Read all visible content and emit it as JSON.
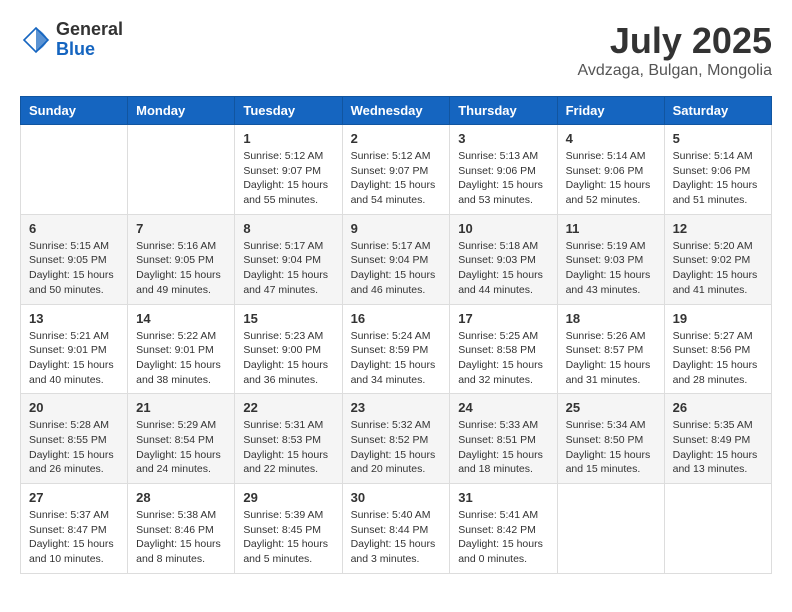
{
  "header": {
    "logo_general": "General",
    "logo_blue": "Blue",
    "title": "July 2025",
    "location": "Avdzaga, Bulgan, Mongolia"
  },
  "days_of_week": [
    "Sunday",
    "Monday",
    "Tuesday",
    "Wednesday",
    "Thursday",
    "Friday",
    "Saturday"
  ],
  "weeks": [
    [
      {
        "day": "",
        "content": ""
      },
      {
        "day": "",
        "content": ""
      },
      {
        "day": "1",
        "content": "Sunrise: 5:12 AM\nSunset: 9:07 PM\nDaylight: 15 hours\nand 55 minutes."
      },
      {
        "day": "2",
        "content": "Sunrise: 5:12 AM\nSunset: 9:07 PM\nDaylight: 15 hours\nand 54 minutes."
      },
      {
        "day": "3",
        "content": "Sunrise: 5:13 AM\nSunset: 9:06 PM\nDaylight: 15 hours\nand 53 minutes."
      },
      {
        "day": "4",
        "content": "Sunrise: 5:14 AM\nSunset: 9:06 PM\nDaylight: 15 hours\nand 52 minutes."
      },
      {
        "day": "5",
        "content": "Sunrise: 5:14 AM\nSunset: 9:06 PM\nDaylight: 15 hours\nand 51 minutes."
      }
    ],
    [
      {
        "day": "6",
        "content": "Sunrise: 5:15 AM\nSunset: 9:05 PM\nDaylight: 15 hours\nand 50 minutes."
      },
      {
        "day": "7",
        "content": "Sunrise: 5:16 AM\nSunset: 9:05 PM\nDaylight: 15 hours\nand 49 minutes."
      },
      {
        "day": "8",
        "content": "Sunrise: 5:17 AM\nSunset: 9:04 PM\nDaylight: 15 hours\nand 47 minutes."
      },
      {
        "day": "9",
        "content": "Sunrise: 5:17 AM\nSunset: 9:04 PM\nDaylight: 15 hours\nand 46 minutes."
      },
      {
        "day": "10",
        "content": "Sunrise: 5:18 AM\nSunset: 9:03 PM\nDaylight: 15 hours\nand 44 minutes."
      },
      {
        "day": "11",
        "content": "Sunrise: 5:19 AM\nSunset: 9:03 PM\nDaylight: 15 hours\nand 43 minutes."
      },
      {
        "day": "12",
        "content": "Sunrise: 5:20 AM\nSunset: 9:02 PM\nDaylight: 15 hours\nand 41 minutes."
      }
    ],
    [
      {
        "day": "13",
        "content": "Sunrise: 5:21 AM\nSunset: 9:01 PM\nDaylight: 15 hours\nand 40 minutes."
      },
      {
        "day": "14",
        "content": "Sunrise: 5:22 AM\nSunset: 9:01 PM\nDaylight: 15 hours\nand 38 minutes."
      },
      {
        "day": "15",
        "content": "Sunrise: 5:23 AM\nSunset: 9:00 PM\nDaylight: 15 hours\nand 36 minutes."
      },
      {
        "day": "16",
        "content": "Sunrise: 5:24 AM\nSunset: 8:59 PM\nDaylight: 15 hours\nand 34 minutes."
      },
      {
        "day": "17",
        "content": "Sunrise: 5:25 AM\nSunset: 8:58 PM\nDaylight: 15 hours\nand 32 minutes."
      },
      {
        "day": "18",
        "content": "Sunrise: 5:26 AM\nSunset: 8:57 PM\nDaylight: 15 hours\nand 31 minutes."
      },
      {
        "day": "19",
        "content": "Sunrise: 5:27 AM\nSunset: 8:56 PM\nDaylight: 15 hours\nand 28 minutes."
      }
    ],
    [
      {
        "day": "20",
        "content": "Sunrise: 5:28 AM\nSunset: 8:55 PM\nDaylight: 15 hours\nand 26 minutes."
      },
      {
        "day": "21",
        "content": "Sunrise: 5:29 AM\nSunset: 8:54 PM\nDaylight: 15 hours\nand 24 minutes."
      },
      {
        "day": "22",
        "content": "Sunrise: 5:31 AM\nSunset: 8:53 PM\nDaylight: 15 hours\nand 22 minutes."
      },
      {
        "day": "23",
        "content": "Sunrise: 5:32 AM\nSunset: 8:52 PM\nDaylight: 15 hours\nand 20 minutes."
      },
      {
        "day": "24",
        "content": "Sunrise: 5:33 AM\nSunset: 8:51 PM\nDaylight: 15 hours\nand 18 minutes."
      },
      {
        "day": "25",
        "content": "Sunrise: 5:34 AM\nSunset: 8:50 PM\nDaylight: 15 hours\nand 15 minutes."
      },
      {
        "day": "26",
        "content": "Sunrise: 5:35 AM\nSunset: 8:49 PM\nDaylight: 15 hours\nand 13 minutes."
      }
    ],
    [
      {
        "day": "27",
        "content": "Sunrise: 5:37 AM\nSunset: 8:47 PM\nDaylight: 15 hours\nand 10 minutes."
      },
      {
        "day": "28",
        "content": "Sunrise: 5:38 AM\nSunset: 8:46 PM\nDaylight: 15 hours\nand 8 minutes."
      },
      {
        "day": "29",
        "content": "Sunrise: 5:39 AM\nSunset: 8:45 PM\nDaylight: 15 hours\nand 5 minutes."
      },
      {
        "day": "30",
        "content": "Sunrise: 5:40 AM\nSunset: 8:44 PM\nDaylight: 15 hours\nand 3 minutes."
      },
      {
        "day": "31",
        "content": "Sunrise: 5:41 AM\nSunset: 8:42 PM\nDaylight: 15 hours\nand 0 minutes."
      },
      {
        "day": "",
        "content": ""
      },
      {
        "day": "",
        "content": ""
      }
    ]
  ]
}
